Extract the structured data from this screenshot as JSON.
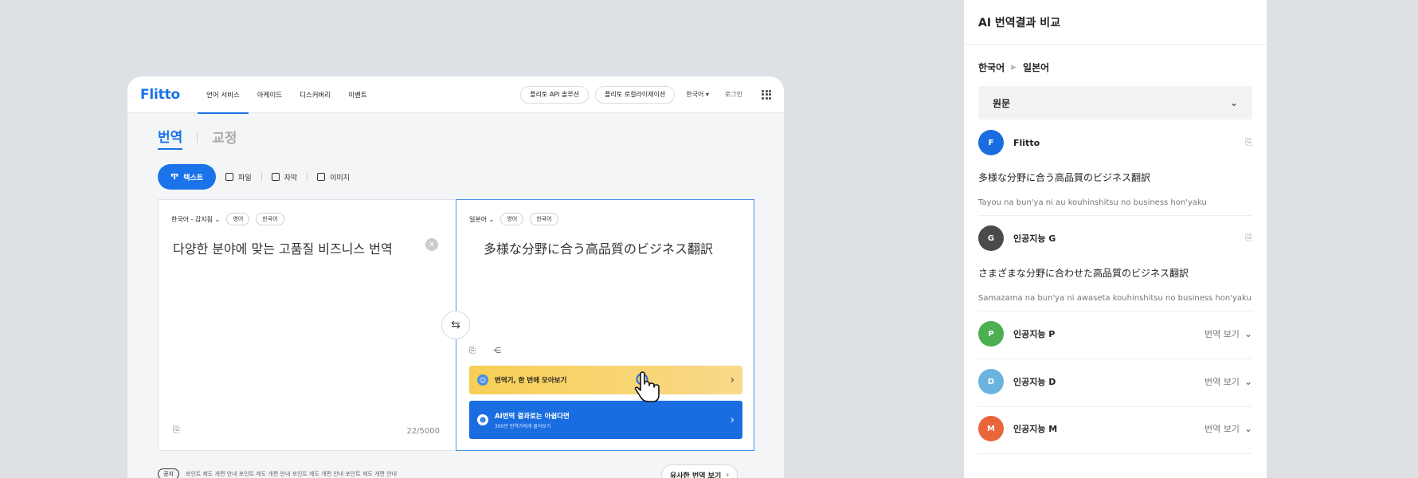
{
  "app": {
    "logo": "Flitto",
    "nav": [
      "언어 서비스",
      "아케이드",
      "디스커버리",
      "이벤트"
    ],
    "buttons": [
      "플리토 API 솔루션",
      "플리토 로컬라이제이션"
    ],
    "language": "한국어 ▾",
    "login": "로그인"
  },
  "tabs": [
    "번역",
    "교정"
  ],
  "modes": [
    "텍스트",
    "파일",
    "자막",
    "이미지"
  ],
  "source": {
    "lang": "한국어 - 감지됨 ⌄",
    "chips": [
      "영어",
      "한국어"
    ],
    "text": "다양한 분야에 맞는 고품질 비즈니스 번역",
    "clear": "✕",
    "counter": "22/5000"
  },
  "target": {
    "lang": "일본어 ⌄",
    "chips": [
      "영어",
      "한국어"
    ],
    "text": "多様な分野に合う高品質のビジネス翻訳"
  },
  "banners": {
    "yellow_title": "번역기, 한 번에 모아보기",
    "blue_title": "AI번역 결과로는 아쉽다면",
    "blue_sub": "300만 번역가에게 물어보기"
  },
  "notice": {
    "tag": "공지",
    "text": "포인트 제도 개편 안내 포인트 제도 개편 안내 포인트 제도 개편 안내 포인트 제도 개편 안내"
  },
  "similar": "유사한 번역 보기",
  "compare": {
    "title": "AI 번역결과 비교",
    "from": "한국어",
    "to": "일본어",
    "original_label": "원문",
    "more_label": "번역 보기",
    "results": [
      {
        "initial": "F",
        "name": "Flitto",
        "color": "#1a6de0",
        "text": "多様な分野に合う高品質のビジネス翻訳",
        "romaji": "Tayou na bun'ya ni au kouhinshitsu no business hon'yaku"
      },
      {
        "initial": "G",
        "name": "인공지능 G",
        "color": "#4a4a4a",
        "text": "さまざまな分野に合わせた高品質のビジネス翻訳",
        "romaji": "Samazama na bun'ya ni awaseta kouhinshitsu no business hon'yaku"
      },
      {
        "initial": "P",
        "name": "인공지능 P",
        "color": "#4caf50"
      },
      {
        "initial": "D",
        "name": "인공지능 D",
        "color": "#6cb3e0"
      },
      {
        "initial": "M",
        "name": "인공지능 M",
        "color": "#e8663a"
      }
    ]
  }
}
